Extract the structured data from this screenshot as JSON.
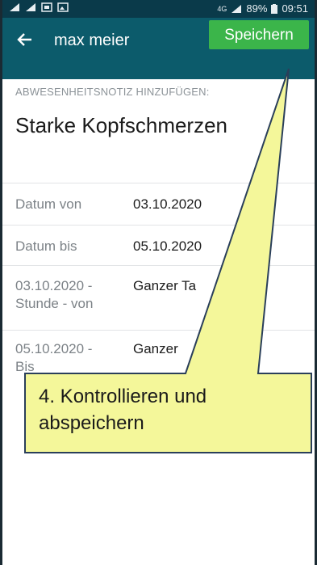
{
  "statusbar": {
    "network": "4G",
    "battery": "89%",
    "time": "09:51",
    "left_icons": [
      "signal-alt-icon",
      "signal-alt-icon",
      "gallery-icon",
      "image-icon"
    ]
  },
  "appbar": {
    "back_icon": "arrow-left-icon",
    "title": "max meier",
    "save_label": "Speichern"
  },
  "form": {
    "section_label": "ABWESENHEITSNOTIZ HINZUFÜGEN:",
    "note": "Starke Kopfschmerzen",
    "rows": [
      {
        "label": "Datum von",
        "value": "03.10.2020"
      },
      {
        "label": "Datum bis",
        "value": "05.10.2020"
      },
      {
        "label": "03.10.2020 - Stunde - von",
        "label_line1": "03.10.2020 -",
        "label_line2": "Stunde - von",
        "value": "Ganzer Ta"
      },
      {
        "label": "05.10.2020 - Bis",
        "label_line1": "05.10.2020 -",
        "label_line2": "Bis",
        "value": "Ganzer"
      }
    ]
  },
  "callout": {
    "line1": "4. Kontrollieren und",
    "line2": "abspeichern",
    "fill": "#f4f79a",
    "stroke": "#2a3f5a"
  },
  "colors": {
    "statusbar": "#0a3a4a",
    "appbar": "#0c5b6b",
    "save_button": "#3bb54a"
  }
}
